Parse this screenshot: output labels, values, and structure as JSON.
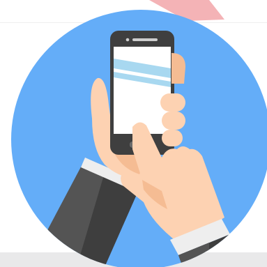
{
  "illustration": {
    "subject": "hand-holding-smartphone-with-tapping-finger",
    "colors": {
      "page_background": "#ffffff",
      "top_band": "#ffffff",
      "bottom_band": "#e9e9ea",
      "pink_tab": "#f4b3b6",
      "circle": "#64adf8",
      "phone_body": "#3f3f3f",
      "phone_screen": "#ffffff",
      "screen_stripe": "#a8d8f0",
      "skin": "#fdd2b2",
      "skin_shadow": "#f5bc93",
      "sleeve": "#545454",
      "sleeve_dark": "#3e3e3e",
      "cuff": "#eeeeee"
    }
  }
}
